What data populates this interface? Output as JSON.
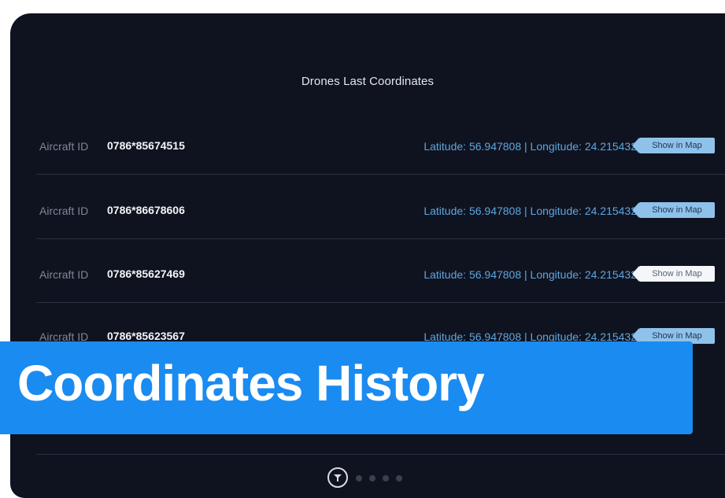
{
  "screen": {
    "title": "Drones Last Coordinates"
  },
  "rows": [
    {
      "label": "Aircraft ID",
      "aircraft_id": "0786*85674515",
      "coords": "Latitude: 56.947808 | Longitude: 24.215432",
      "button": "Show in Map",
      "button_style": "blue"
    },
    {
      "label": "Aircraft ID",
      "aircraft_id": "0786*86678606",
      "coords": "Latitude: 56.947808 | Longitude: 24.215432",
      "button": "Show in Map",
      "button_style": "blue"
    },
    {
      "label": "Aircraft ID",
      "aircraft_id": "0786*85627469",
      "coords": "Latitude: 56.947808 | Longitude: 24.215432",
      "button": "Show in Map",
      "button_style": "white"
    },
    {
      "label": "Aircraft ID",
      "aircraft_id": "0786*85623567",
      "coords": "Latitude: 56.947808 | Longitude: 24.215432",
      "button": "Show in Map",
      "button_style": "blue"
    }
  ],
  "banner": {
    "text": "Coordinates History"
  },
  "pager": {
    "active_icon": "drone-icon",
    "dot_count": 4
  },
  "colors": {
    "background": "#0f1320",
    "accent": "#1a8bf0",
    "coords_text": "#5ea6df",
    "button": "#8fc2ea"
  }
}
